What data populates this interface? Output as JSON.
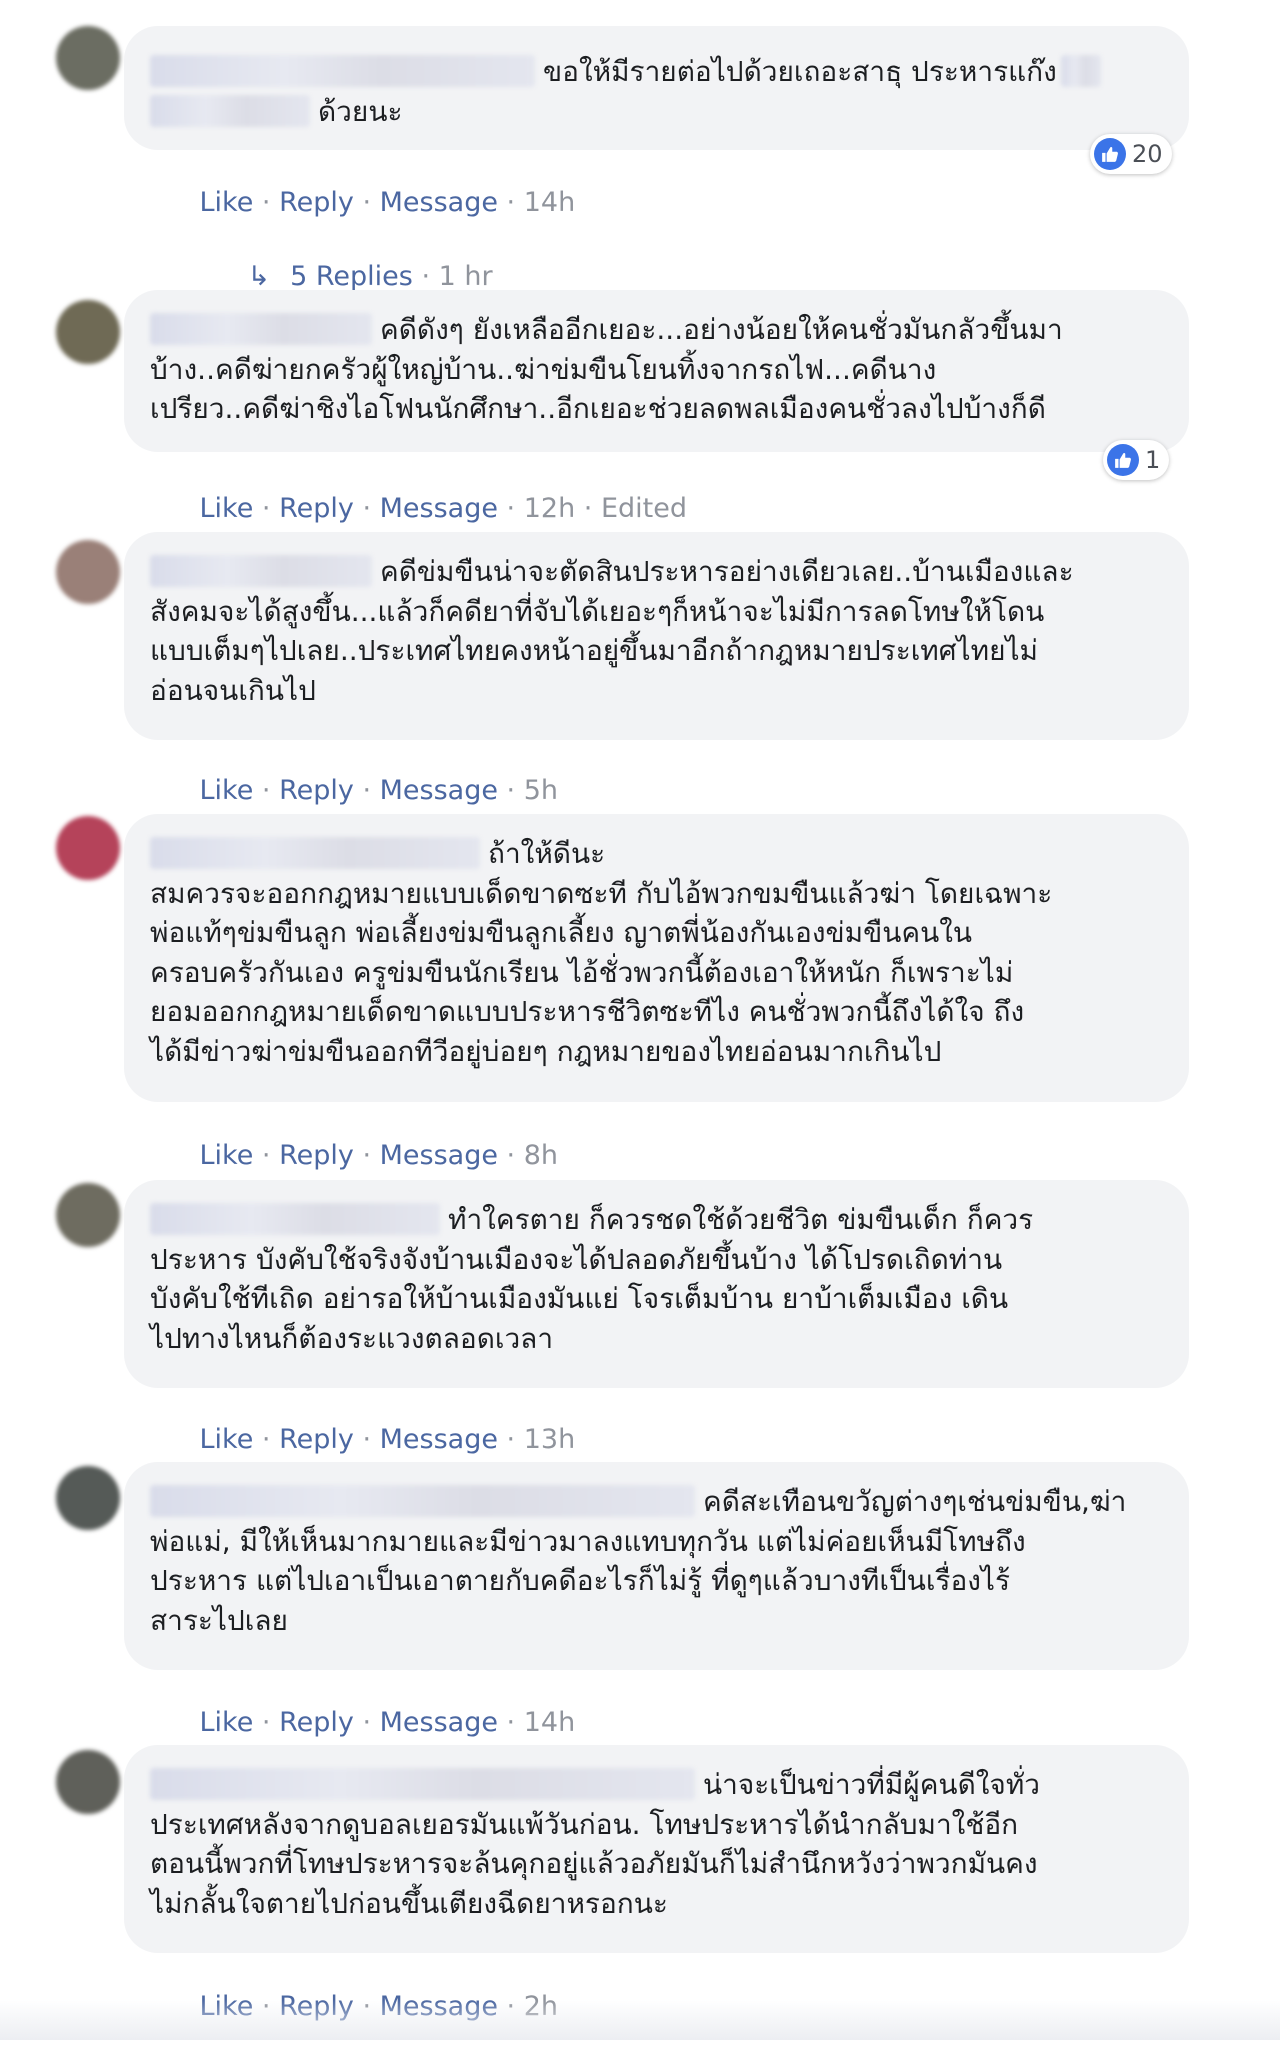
{
  "actions": {
    "like": "Like",
    "reply": "Reply",
    "message": "Message",
    "sep": " · "
  },
  "comments": [
    {
      "avatar_color": "#6b6d62",
      "lines": [
        "ขอให้มีรายต่อไปด้วยเถอะสาธุ ประหารแก๊ง",
        "ด้วยนะ"
      ],
      "time": "14h",
      "edited": "",
      "reaction_count": "20"
    },
    {
      "avatar_color": "#6f6a55",
      "lines": [
        "คดีดังๆ ยังเหลืออีกเยอะ...อย่างน้อยให้คนชั่วมันกลัวขึ้นมา",
        "บ้าง..คดีฆ่ายกครัวผู้ใหญ่บ้าน..ฆ่าข่มขืนโยนทิ้งจากรถไฟ...คดีนาง",
        "เปรียว..คดีฆ่าชิงไอโฟนนักศึกษา..อีกเยอะช่วยลดพลเมืองคนชั่วลงไปบ้างก็ดี"
      ],
      "time": "12h",
      "edited": "Edited",
      "reaction_count": "1"
    },
    {
      "avatar_color": "#9a8078",
      "lines": [
        "คดีข่มขืนน่าจะตัดสินประหารอย่างเดียวเลย..บ้านเมืองและ",
        "สังคมจะได้สูงขึ้น...แล้วก็คดียาที่จับได้เยอะๆก็หน้าจะไม่มีการลดโทษให้โดน",
        "แบบเต็มๆไปเลย..ประเทศไทยคงหน้าอยู่ขึ้นมาอีกถ้ากฎหมายประเทศไทยไม่",
        "อ่อนจนเกินไป"
      ],
      "time": "5h",
      "edited": "",
      "reaction_count": ""
    },
    {
      "avatar_color": "#b5435a",
      "lines": [
        "ถ้าให้ดีนะ",
        "สมควรจะออกกฎหมายแบบเด็ดขาดซะที กับไอ้พวกขมขืนแล้วฆ่า โดยเฉพาะ",
        "พ่อแท้ๆข่มขืนลูก พ่อเลี้ยงข่มขืนลูกเลี้ยง ญาตพี่น้องกันเองข่มขืนคนใน",
        "ครอบครัวกันเอง ครูข่มขืนนักเรียน ไอ้ชั่วพวกนี้ต้องเอาให้หนัก ก็เพราะไม่",
        "ยอมออกกฎหมายเด็ดขาดแบบประหารชีวิตซะทีไง คนชั่วพวกนี้ถึงได้ใจ ถึง",
        "ได้มีข่าวฆ่าข่มขืนออกทีวีอยู่บ่อยๆ กฎหมายของไทยอ่อนมากเกินไป"
      ],
      "time": "8h",
      "edited": "",
      "reaction_count": ""
    },
    {
      "avatar_color": "#6e6c60",
      "lines": [
        "ทำใครตาย ก็ควรชดใช้ด้วยชีวิต ข่มขืนเด็ก ก็ควร",
        "ประหาร บังคับใช้จริงจังบ้านเมืองจะได้ปลอดภัยขึ้นบ้าง ได้โปรดเถิดท่าน",
        "บังคับใช้ทีเถิด อย่ารอให้บ้านเมืองมันแย่ โจรเต็มบ้าน ยาบ้าเต็มเมือง เดิน",
        "ไปทางไหนก็ต้องระแวงตลอดเวลา"
      ],
      "time": "13h",
      "edited": "",
      "reaction_count": ""
    },
    {
      "avatar_color": "#555a57",
      "lines": [
        "คดีสะเทือนขวัญต่างๆเช่นข่มขืน,ฆ่า",
        "พ่อแม่, มีให้เห็นมากมายและมีข่าวมาลงแทบทุกวัน แต่ไม่ค่อยเห็นมีโทษถึง",
        "ประหาร แต่ไปเอาเป็นเอาตายกับคดีอะไรก็ไม่รู้ ที่ดูๆแล้วบางทีเป็นเรื่องไร้",
        "สาระไปเลย"
      ],
      "time": "14h",
      "edited": "",
      "reaction_count": ""
    },
    {
      "avatar_color": "#5f605a",
      "lines": [
        "น่าจะเป็นข่าวที่มีผู้คนดีใจทั่ว",
        "ประเทศหลังจากดูบอลเยอรมันแพ้วันก่อน. โทษประหารได้นำกลับมาใช้อีก",
        "ตอนนี้พวกที่โทษประหารจะล้นคุกอยู่แล้วอภัยมันก็ไม่สำนึกหวังว่าพวกมันคง",
        "ไม่กลั้นใจตายไปก่อนขึ้นเตียงฉีดยาหรอกนะ"
      ],
      "time": "2h",
      "edited": "",
      "reaction_count": ""
    }
  ],
  "replies": {
    "arrow": "↳",
    "label": "5 Replies",
    "time": "1 hr"
  },
  "colors": {
    "link": "#4b67a1",
    "meta": "#90949c",
    "bubble": "#f2f3f5",
    "like_blue": "#3b74e8"
  }
}
